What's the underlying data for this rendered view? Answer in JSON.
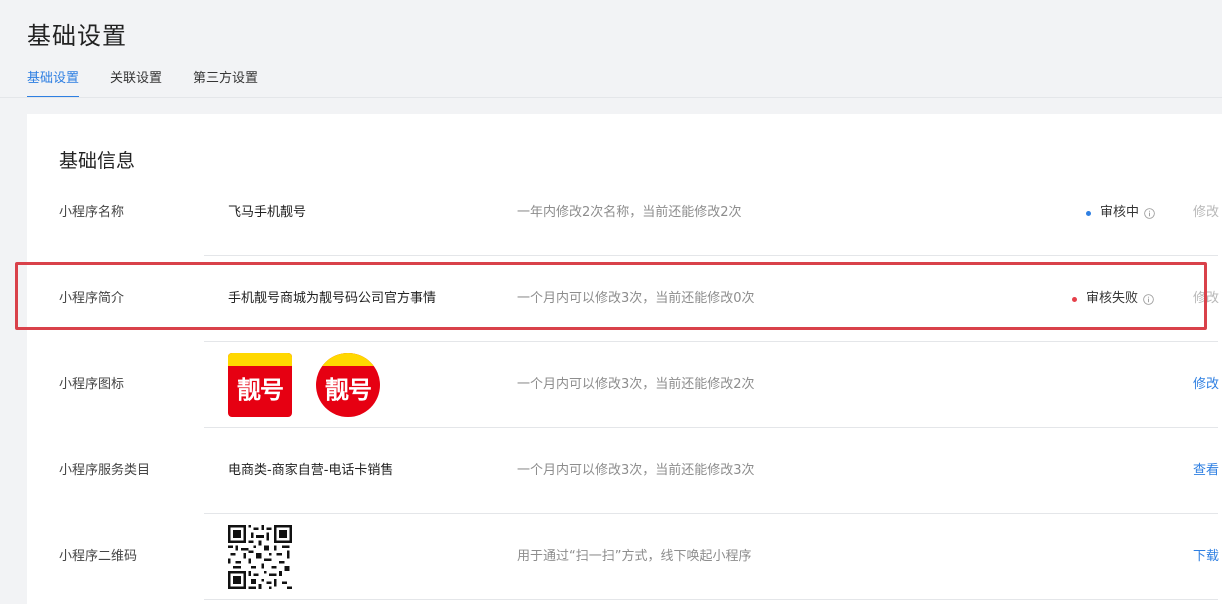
{
  "header": {
    "title": "基础设置"
  },
  "tabs": [
    {
      "label": "基础设置",
      "active": true
    },
    {
      "label": "关联设置",
      "active": false
    },
    {
      "label": "第三方设置",
      "active": false
    }
  ],
  "section": {
    "title": "基础信息"
  },
  "rows": [
    {
      "label": "小程序名称",
      "value": "飞马手机靓号",
      "hint": "一年内修改2次名称，当前还能修改2次",
      "status": "审核中",
      "status_color": "#2e7fe2",
      "action": "修改",
      "action_enabled": false
    },
    {
      "label": "小程序简介",
      "value": "手机靓号商城为靓号码公司官方事情",
      "hint": "一个月内可以修改3次，当前还能修改0次",
      "status": "审核失败",
      "status_color": "#e5404a",
      "action": "修改",
      "action_enabled": false
    },
    {
      "label": "小程序图标",
      "icon_text": "靓号",
      "hint": "一个月内可以修改3次，当前还能修改2次",
      "action": "修改",
      "action_enabled": true
    },
    {
      "label": "小程序服务类目",
      "value": "电商类-商家自营-电话卡销售",
      "hint": "一个月内可以修改3次，当前还能修改3次",
      "action": "查看",
      "action_enabled": true
    },
    {
      "label": "小程序二维码",
      "hint": "用于通过“扫一扫”方式，线下唤起小程序",
      "action": "下载",
      "action_enabled": true
    }
  ],
  "colors": {
    "accent": "#2e7fe2",
    "error": "#e5404a",
    "highlight_border": "#d9414a",
    "icon_red": "#e60012",
    "icon_yellow": "#ffd800"
  },
  "icons": {
    "info": "info-circle-icon",
    "qr": "qr-code-image"
  }
}
